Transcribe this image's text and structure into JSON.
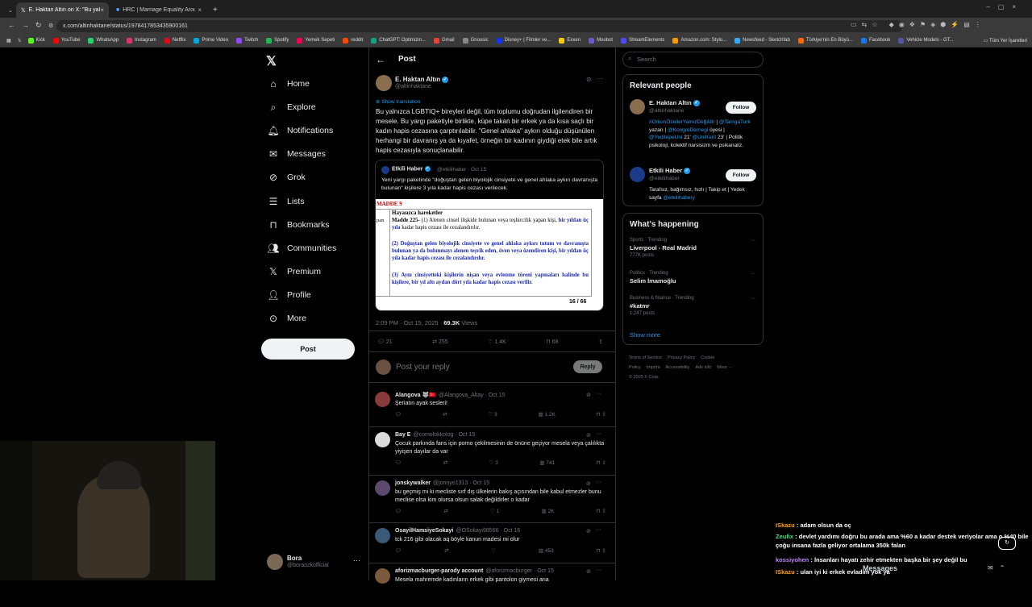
{
  "browser": {
    "tabs": [
      {
        "label": "E. Haktan Altın on X: \"Bu yalnızca",
        "active": true
      },
      {
        "label": "HRC | Marriage Equality Aroun",
        "active": false
      }
    ],
    "url": "x.com/altinhaktane/status/1978417853435900161",
    "bookmarks": [
      "Kick",
      "YouTube",
      "WhatsApp",
      "Instagram",
      "Netflix",
      "Prime Video",
      "Twitch",
      "Spotify",
      "Yemek Sepeti",
      "reddit",
      "ChatGPT: Optimizin...",
      "Gmail",
      "Gnoosic",
      "Disney+ | Filmler ve...",
      "Exxen",
      "Moobot",
      "StreamElements",
      "Amazon.com: Stylo...",
      "Newsfeed - Sketchfab",
      "Türkiye'nin En Büyü...",
      "Facebook",
      "Vehicle Models - GT..."
    ],
    "all_bookmarks": "Tüm Yer İşaretleri"
  },
  "nav": {
    "items": [
      "Home",
      "Explore",
      "Notifications",
      "Messages",
      "Grok",
      "Lists",
      "Bookmarks",
      "Communities",
      "Premium",
      "Profile",
      "More"
    ],
    "post_button": "Post",
    "account_name": "Bora",
    "account_handle": "@boraozkofficial"
  },
  "header": {
    "title": "Post"
  },
  "tweet": {
    "author": "E. Haktan Altın",
    "handle": "@altinhaktane",
    "show_translation": "Show translation",
    "text": "Bu yalnızca LGBTIQ+ bireyleri değil, tüm toplumu doğrudan ilgilendiren bir mesele. Bu yargı paketiyle birlikte, küpe takan bir erkek ya da kısa saçlı bir kadın hapis cezasına çarptırılabilir. \"Genel ahlaka\" aykırı olduğu düşünülen herhangi bir davranış ya da kıyafet, örneğin bir kadının giydiği etek bile artık hapis cezasıyla sonuçlanabilir.",
    "quote_author": "Etkili Haber",
    "quote_meta": "@etkilihaber · Oct 15",
    "quote_text": "Yeni yargı paketinde \"doğuştan gelen biyolojik cinsiyete ve genel ahlaka aykırı davranışta bulunan\" kişilere 3 yıla kadar hapis cezası verilecek.",
    "doc": {
      "madde": "MADDE 9",
      "left_fragment": "pan",
      "heading": "Hayasızca hareketler",
      "p1_label": "Madde 225-",
      "p1": " (1) Alenen cinsel ilişkide bulunan veya teşhircilik yapan kişi, ",
      "p1_highlight": "bir yıldan üç yıla",
      "p1_end": " kadar hapis cezası ile cezalandırılır.",
      "p2": "(2) Doğuştan gelen biyolojik cinsiyete ve genel ahlaka aykırı tutum ve davranışta bulunan ya da bulunmayı alenen teşvik eden, öven veya özendiren kişi, bir yıldan üç yıla kadar hapis cezası ile cezalandırılır.",
      "p3": "(3) Aynı cinsiyetteki kişilerin nişan veya evlenme töreni yapmaları halinde bu kişilere, bir yıl altı aydan dört yıla kadar hapis cezası verilir.",
      "page": "16 / 66"
    },
    "time": "2:09 PM · Oct 15, 2025 · ",
    "views_count": "69.3K",
    "views_label": " Views",
    "replies": "21",
    "reposts": "255",
    "likes": "1.4K",
    "bookmarks": "68",
    "reply_placeholder": "Post your reply",
    "reply_button": "Reply"
  },
  "replies": [
    {
      "name": "Alangova 🐺🇹🇷",
      "handle": "@Alangova_Altay · Oct 15",
      "text": "Şeriatın ayak sesleri!",
      "likes": "3",
      "views": "1.2K"
    },
    {
      "name": "Bay E",
      "handle": "@comolokkolog · Oct 15",
      "text": "Çocuk parkında fans için porno çekilmesinin de önüne geçiyor mesela veya çalılıkta yiyişen dayılar da var",
      "likes": "3",
      "views": "741"
    },
    {
      "name": "jonskywalker",
      "handle": "@jonnyo1313 · Oct 15",
      "text": "bu geçmiş mi ki mecliste sırf dış ülkelerin bakış açısından bile kabul etmezler bunu meclise olsa kim olursa olsun salak değildirler o kadar",
      "likes": "1",
      "views": "2K"
    },
    {
      "name": "OsayilHamsiyeSokayi",
      "handle": "@OSokayi98566 · Oct 16",
      "text": "tck 216 gibi olacak aq böyle kanun madesi mi olur",
      "likes": "",
      "views": "453"
    },
    {
      "name": "aforizmacburger-parody account",
      "handle": "@aforizmacburger · Oct 15",
      "text": "Mesela mahremde kadınların erkek gibi pantolon giymesi ana",
      "likes": "",
      "views": ""
    }
  ],
  "search": {
    "placeholder": "Search"
  },
  "relevant": {
    "title": "Relevant people",
    "people": [
      {
        "name": "E. Haktan Altın",
        "handle": "@altinhaktane",
        "follow": "Follow",
        "bio_parts": [
          "#OrkunÖzellerYalnızDeğildir",
          " | ",
          "@TamgaTurk",
          " yazarı | ",
          "@KongreDernegi",
          " üyesi | ",
          "@YeditepeUni",
          " 21' ",
          "@UniKent",
          " 23' | Politik psikoloji, kolektif narsisizm ve psikanaliz."
        ]
      },
      {
        "name": "Etkili Haber",
        "handle": "@etkilihaber",
        "follow": "Follow",
        "bio_parts": [
          "Tarafsız, bağımsız, hızlı | Takip et | Yedek sayfa ",
          "@etkilihabery"
        ]
      }
    ]
  },
  "happening": {
    "title": "What's happening",
    "trends": [
      {
        "meta": "Sports · Trending",
        "name": "Liverpool - Real Madrid",
        "posts": "777K posts"
      },
      {
        "meta": "Politics · Trending",
        "name": "Selim İmamoğlu",
        "posts": ""
      },
      {
        "meta": "Business & finance · Trending",
        "name": "#katmr",
        "posts": "1,247 posts"
      }
    ],
    "show_more": "Show more"
  },
  "footer": {
    "links": [
      "Terms of Service",
      "Privacy Policy",
      "Cookie Policy",
      "Imprint",
      "Accessibility",
      "Ads info",
      "More ···"
    ],
    "copyright": "© 2025 X Corp."
  },
  "chat": [
    {
      "user": "ISkazu",
      "color": "#ff9f1c",
      "text": "adam olsun da oç"
    },
    {
      "user": "Zeufix",
      "color": "#4ade80",
      "text": "devlet yardımı doğru bu arada ama %60 a kadar destek veriyolar ama o %40 bile çoğu insana fazla geliyor ortalama 350k falan"
    },
    {
      "user": "kossiyohen",
      "color": "#c084fc",
      "text": "İnsanları hayatı zehir etmekten başka bir şey değil bu"
    },
    {
      "user": "ISkazu",
      "color": "#ff9f1c",
      "text": "ulan iyi ki erkek evladım yok ya"
    }
  ],
  "messages_drawer": "Messages",
  "colors": {
    "accent": "#1d9bf0",
    "bg": "#000000",
    "border": "#2f3336",
    "muted": "#71767b"
  }
}
